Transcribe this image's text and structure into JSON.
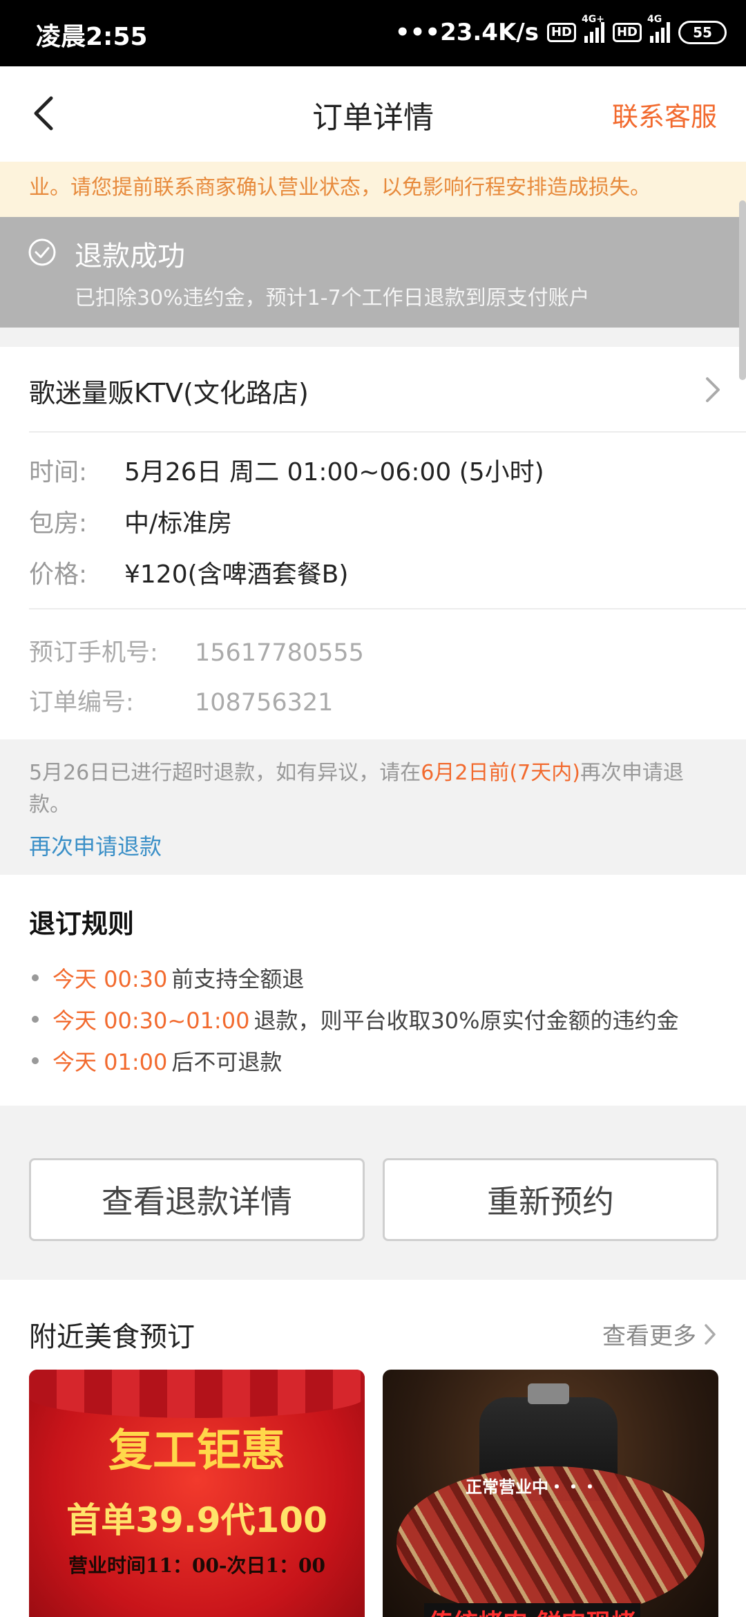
{
  "status_bar": {
    "time": "凌晨2:55",
    "net_speed": "•••23.4K/s",
    "hd1": "HD",
    "net1": "4G+",
    "hd2": "HD",
    "net2": "4G",
    "battery": "55"
  },
  "header": {
    "title": "订单详情",
    "service": "联系客服"
  },
  "notice": "业。请您提前联系商家确认营业状态，以免影响行程安排造成损失。",
  "refund_status": {
    "title": "退款成功",
    "desc": "已扣除30%违约金，预计1-7个工作日退款到原支付账户"
  },
  "order": {
    "store": "歌迷量贩KTV(文化路店)",
    "time_label": "时间:",
    "time_value": "5月26日 周二 01:00~06:00 (5小时)",
    "room_label": "包房:",
    "room_value": "中/标准房",
    "price_label": "价格:",
    "price_value": "¥120(含啤酒套餐B)",
    "phone_label": "预订手机号:",
    "phone_value": "15617780555",
    "orderno_label": "订单编号:",
    "orderno_value": "108756321"
  },
  "timeout": {
    "pre": "5月26日已进行超时退款，如有异议，请在",
    "highlight": "6月2日前(7天内)",
    "post": "再次申请退款。",
    "link": "再次申请退款"
  },
  "rules": {
    "title": "退订规则",
    "items": [
      {
        "time": "今天 00:30",
        "text": "前支持全额退"
      },
      {
        "time": "今天 00:30~01:00",
        "text": "退款，则平台收取30%原实付金额的违约金"
      },
      {
        "time": "今天 01:00",
        "text": "后不可退款"
      }
    ]
  },
  "buttons": {
    "refund_detail": "查看退款详情",
    "rebook": "重新预约"
  },
  "nearby": {
    "title": "附近美食预订",
    "more": "查看更多",
    "tile1": {
      "headline": "复工钜惠",
      "offer": "首单39.9代100",
      "hours": "营业时间11：00-次日1：00"
    },
    "tile2": {
      "open": "正常营业中・・・",
      "slogan": "传统烤肉 鲜肉现烤"
    }
  },
  "colors": {
    "accent": "#f26a2e",
    "link": "#3a8fc7",
    "status_bg": "#b3b3b3",
    "notice_bg": "#fdf3dc"
  }
}
